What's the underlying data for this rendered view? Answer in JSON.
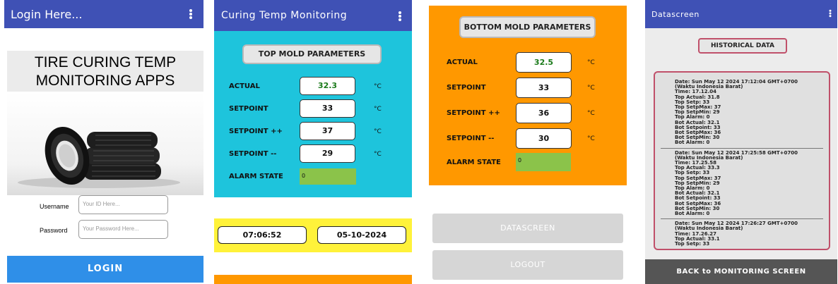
{
  "login": {
    "appbar_title": "Login Here...",
    "headline_line1": "TIRE CURING TEMP",
    "headline_line2": "MONITORING APPS",
    "username_label": "Username",
    "username_placeholder": "Your ID Here...",
    "password_label": "Password",
    "password_placeholder": "Your Password Here...",
    "login_button": "LOGIN",
    "colors": {
      "appbar": "#3f51b5",
      "login_button": "#2f8fe8"
    }
  },
  "top_mold": {
    "appbar_title": "Curing Temp Monitoring",
    "section_button": "TOP MOLD PARAMETERS",
    "rows": [
      {
        "label": "ACTUAL",
        "value": "32.3",
        "unit": "°C"
      },
      {
        "label": "SETPOINT",
        "value": "33",
        "unit": "°C"
      },
      {
        "label": "SETPOINT ++",
        "value": "37",
        "unit": "°C"
      },
      {
        "label": "SETPOINT --",
        "value": "29",
        "unit": "°C"
      }
    ],
    "alarm_label": "ALARM STATE",
    "alarm_value": "0",
    "time": "07:06:52",
    "date": "05-10-2024",
    "colors": {
      "background": "#1ec4dc",
      "footer": "#fff23a",
      "alarm": "#8bc34a"
    }
  },
  "bottom_mold": {
    "section_button": "BOTTOM MOLD PARAMETERS",
    "rows": [
      {
        "label": "ACTUAL",
        "value": "32.5",
        "unit": "°C"
      },
      {
        "label": "SETPOINT",
        "value": "33",
        "unit": "°C"
      },
      {
        "label": "SETPOINT ++",
        "value": "36",
        "unit": "°C"
      },
      {
        "label": "SETPOINT --",
        "value": "30",
        "unit": "°C"
      }
    ],
    "alarm_label": "ALARM STATE",
    "alarm_value": "0",
    "datascreen_button": "DATASCREEN",
    "logout_button": "LOGOUT",
    "colors": {
      "background": "#ff9800"
    }
  },
  "datascreen": {
    "appbar_title": "Datascreen",
    "historical_button": "HISTORICAL DATA",
    "records": [
      [
        "Date: Sun May 12 2024 17:12:04 GMT+0700",
        "(Waktu Indonesia Barat)",
        "Time: 17.12.04",
        "Top Actual: 31.8",
        "Top Setp: 33",
        "Top SetpMax: 37",
        "Top SetpMin: 29",
        "Top Alarm: 0",
        "Bot Actual: 32.1",
        "Bot Setpoint: 33",
        "Bot SetpMax: 36",
        "Bot SetpMin: 30",
        "Bot Alarm: 0"
      ],
      [
        "Date: Sun May 12 2024 17:25:58 GMT+0700",
        "(Waktu Indonesia Barat)",
        "Time: 17.25.58",
        "Top Actual: 33.3",
        "Top Setp: 33",
        "Top SetpMax: 37",
        "Top SetpMin: 29",
        "Top Alarm: 0",
        "Bot Actual: 32.1",
        "Bot Setpoint: 33",
        "Bot SetpMax: 36",
        "Bot SetpMin: 30",
        "Bot Alarm: 0"
      ],
      [
        "Date: Sun May 12 2024 17:26:27 GMT+0700",
        "(Waktu Indonesia Barat)",
        "Time: 17.26.27",
        "Top Actual: 33.1",
        "Top Setp: 33"
      ]
    ],
    "back_button": "BACK to MONITORING SCREEN"
  }
}
